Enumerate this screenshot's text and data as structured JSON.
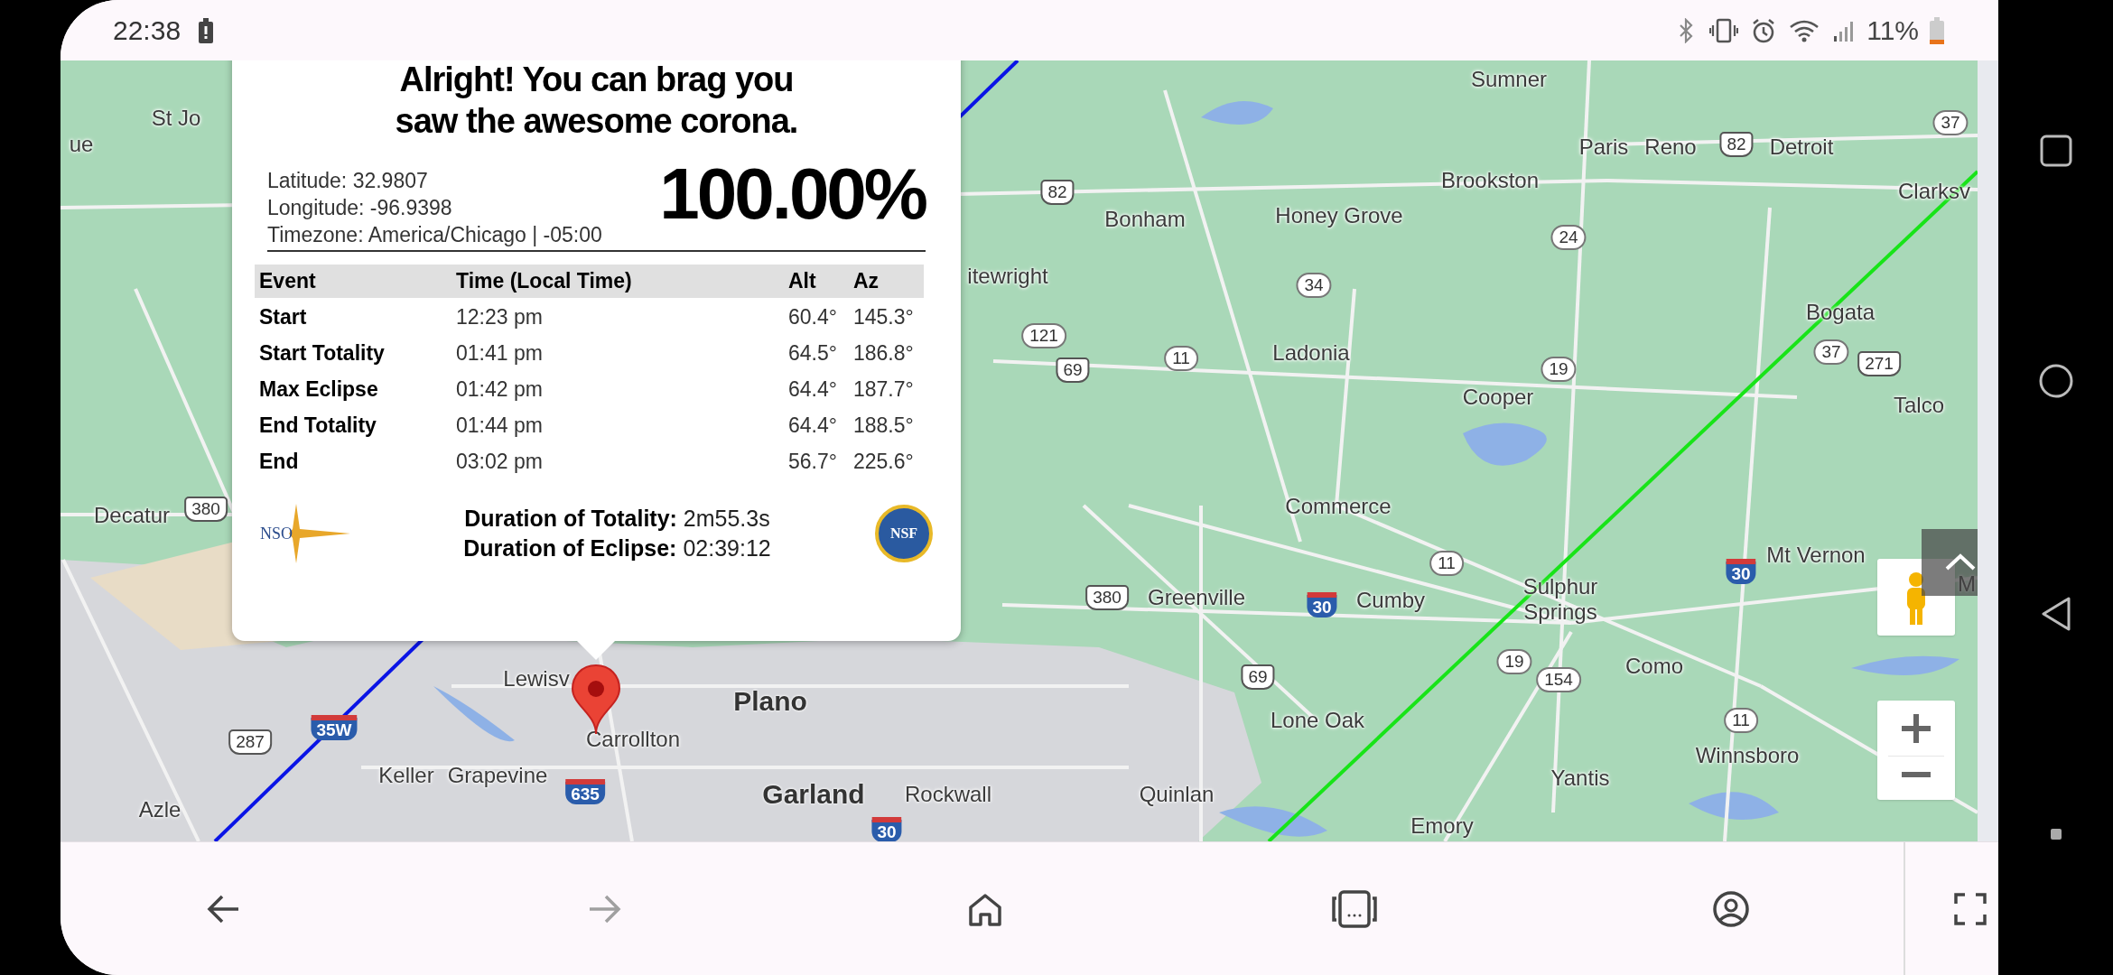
{
  "status_bar": {
    "time": "22:38",
    "battery": "11%"
  },
  "popup": {
    "headline": [
      "Alright! You can brag you",
      "saw the awesome corona."
    ],
    "location": [
      "Latitude: 32.9807",
      "Longitude: -96.9398",
      "Timezone: America/Chicago | -05:00"
    ],
    "coverage": "100.00%",
    "table": {
      "columns": [
        "Event",
        "Time (Local Time)",
        "Alt",
        "Az"
      ],
      "rows": [
        {
          "event": "Start",
          "time": "12:23 pm",
          "alt": "60.4°",
          "az": "145.3°"
        },
        {
          "event": "Start Totality",
          "time": "01:41 pm",
          "alt": "64.5°",
          "az": "186.8°"
        },
        {
          "event": "Max Eclipse",
          "time": "01:42 pm",
          "alt": "64.4°",
          "az": "187.7°"
        },
        {
          "event": "End Totality",
          "time": "01:44 pm",
          "alt": "64.4°",
          "az": "188.5°"
        },
        {
          "event": "End",
          "time": "03:02 pm",
          "alt": "56.7°",
          "az": "225.6°"
        }
      ]
    },
    "durations": [
      {
        "label": "Duration of Totality:",
        "value": "2m55.3s"
      },
      {
        "label": "Duration of Eclipse:",
        "value": "02:39:12"
      }
    ],
    "logos": [
      "NSO",
      "NSF"
    ]
  },
  "map": {
    "labels": [
      {
        "text": "ue",
        "kind": "place"
      },
      {
        "text": "St Jo",
        "kind": "place"
      },
      {
        "text": "Sumner",
        "kind": "place"
      },
      {
        "text": "Paris",
        "kind": "place"
      },
      {
        "text": "Reno",
        "kind": "place"
      },
      {
        "text": "Detroit",
        "kind": "place"
      },
      {
        "text": "Brookston",
        "kind": "place"
      },
      {
        "text": "Clarksv",
        "kind": "place"
      },
      {
        "text": "Bonham",
        "kind": "place"
      },
      {
        "text": "Honey Grove",
        "kind": "place"
      },
      {
        "text": "itewright",
        "kind": "place"
      },
      {
        "text": "Bogata",
        "kind": "place"
      },
      {
        "text": "Ladonia",
        "kind": "place"
      },
      {
        "text": "Cooper",
        "kind": "place"
      },
      {
        "text": "Talco",
        "kind": "place"
      },
      {
        "text": "Decatur",
        "kind": "place"
      },
      {
        "text": "Commerce",
        "kind": "place"
      },
      {
        "text": "Mt Vernon",
        "kind": "place"
      },
      {
        "text": "M",
        "kind": "place"
      },
      {
        "text": "Greenville",
        "kind": "place"
      },
      {
        "text": "Cumby",
        "kind": "place"
      },
      {
        "text": "Sulphur Springs",
        "kind": "place"
      },
      {
        "text": "Como",
        "kind": "place"
      },
      {
        "text": "Lewisv",
        "kind": "place"
      },
      {
        "text": "Plano",
        "kind": "city"
      },
      {
        "text": "Carrollton",
        "kind": "place"
      },
      {
        "text": "Lone Oak",
        "kind": "place"
      },
      {
        "text": "Winnsboro",
        "kind": "place"
      },
      {
        "text": "Keller",
        "kind": "place"
      },
      {
        "text": "Grapevine",
        "kind": "place"
      },
      {
        "text": "Yantis",
        "kind": "place"
      },
      {
        "text": "Azle",
        "kind": "place"
      },
      {
        "text": "Garland",
        "kind": "city"
      },
      {
        "text": "Rockwall",
        "kind": "place"
      },
      {
        "text": "Quinlan",
        "kind": "place"
      },
      {
        "text": "Emory",
        "kind": "place"
      },
      {
        "text": "82",
        "kind": "us"
      },
      {
        "text": "37",
        "kind": "state"
      },
      {
        "text": "82",
        "kind": "us"
      },
      {
        "text": "24",
        "kind": "state"
      },
      {
        "text": "34",
        "kind": "state"
      },
      {
        "text": "121",
        "kind": "state"
      },
      {
        "text": "69",
        "kind": "us"
      },
      {
        "text": "11",
        "kind": "state"
      },
      {
        "text": "19",
        "kind": "state"
      },
      {
        "text": "37",
        "kind": "state"
      },
      {
        "text": "271",
        "kind": "us"
      },
      {
        "text": "380",
        "kind": "us"
      },
      {
        "text": "11",
        "kind": "state"
      },
      {
        "text": "380",
        "kind": "us"
      },
      {
        "text": "30",
        "kind": "interstate"
      },
      {
        "text": "30",
        "kind": "interstate"
      },
      {
        "text": "69",
        "kind": "us"
      },
      {
        "text": "19",
        "kind": "state"
      },
      {
        "text": "154",
        "kind": "state"
      },
      {
        "text": "11",
        "kind": "state"
      },
      {
        "text": "287",
        "kind": "us"
      },
      {
        "text": "35W",
        "kind": "interstate"
      },
      {
        "text": "635",
        "kind": "interstate"
      },
      {
        "text": "30",
        "kind": "interstate"
      }
    ]
  },
  "browser_toolbar": {
    "buttons": [
      {
        "kind": "back",
        "disabled": false
      },
      {
        "kind": "forward",
        "disabled": true
      },
      {
        "kind": "home",
        "disabled": false
      },
      {
        "kind": "tabs",
        "disabled": false
      },
      {
        "kind": "profile",
        "disabled": false
      },
      {
        "kind": "fullscreen",
        "disabled": false
      }
    ]
  }
}
